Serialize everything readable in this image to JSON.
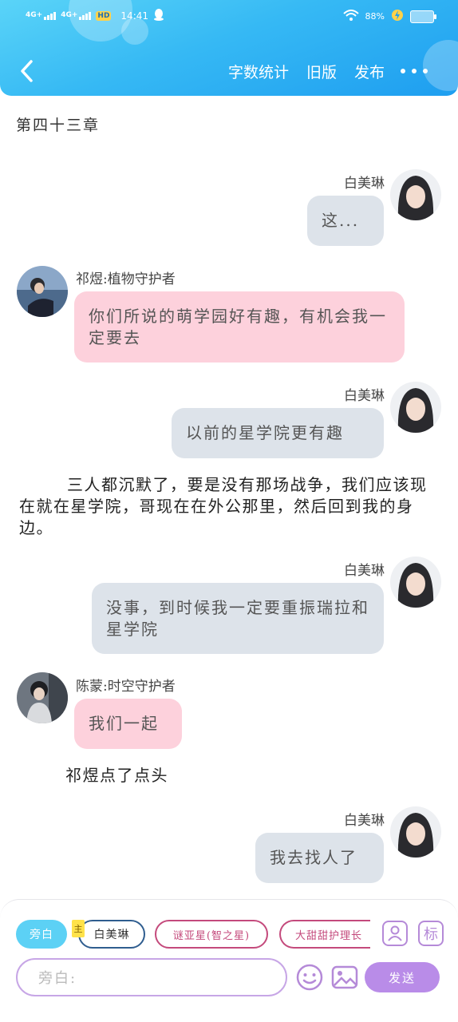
{
  "status_bar": {
    "net1": "4G+",
    "net2": "4G+",
    "hd": "HD",
    "time": "14:41",
    "battery": "88%"
  },
  "header": {
    "actions": [
      "字数统计",
      "旧版",
      "发布"
    ]
  },
  "chapter_title": "第四十三章",
  "messages": [
    {
      "speaker": "白美琳",
      "text": "这..."
    },
    {
      "speaker": "祁煜:植物守护者",
      "text": "你们所说的萌学园好有趣，有机会我一定要去"
    },
    {
      "speaker": "白美琳",
      "text": "以前的星学院更有趣"
    },
    {
      "speaker": "白美琳",
      "text": "没事，到时候我一定要重振瑞拉和星学院"
    },
    {
      "speaker": "陈蒙:时空守护者",
      "text": "我们一起"
    },
    {
      "speaker": "白美琳",
      "text": "我去找人了"
    }
  ],
  "narration": [
    "三人都沉默了，要是没有那场战争，我们应该现在就在星学院，哥现在在外公那里，然后回到我的身边。",
    "祁煜点了点头"
  ],
  "composer": {
    "narrator_chip": "旁白",
    "main_tag": "主",
    "role_chips": [
      "白美琳",
      "谜亚星(智之星)",
      "大甜甜护理长"
    ],
    "input_placeholder": "旁白:",
    "mark_label": "标",
    "send_label": "发送"
  },
  "colors": {
    "header": "#36b9f4",
    "gray_bubble": "#dde3ea",
    "pink_bubble": "#fdd1dc",
    "send": "#b98ce8"
  }
}
